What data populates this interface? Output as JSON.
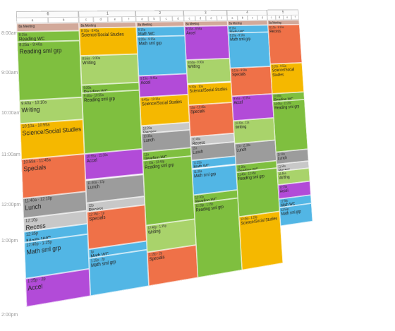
{
  "colors": {
    "green": "#7fbf3f",
    "lightgreen": "#a9d36b",
    "yellow": "#f5b800",
    "orange": "#ef7148",
    "purple": "#b24bd8",
    "gray": "#9c9c9c",
    "lightgray": "#c8c8c8",
    "blue": "#52b6e5",
    "tan": "#d2a99a"
  },
  "times": [
    "8:00am",
    "9:00am",
    "10:00am",
    "11:00am",
    "12:00pm",
    "1:00pm",
    "2:00pm"
  ],
  "days": [
    {
      "label": "6",
      "subs": [
        "a",
        "b"
      ],
      "events": [
        {
          "time": "",
          "title": "8a Meeting",
          "color": "tan",
          "start": 8.0,
          "end": 8.18,
          "small": true
        },
        {
          "time": "8:15a",
          "title": "Reading WC",
          "color": "green",
          "start": 8.18,
          "end": 8.4
        },
        {
          "time": "8:25a - 9:40a",
          "title": "Reading sml grp",
          "color": "green",
          "start": 8.4,
          "end": 9.67,
          "big": true
        },
        {
          "time": "9:40a - 10:10a",
          "title": "Writing",
          "color": "lightgreen",
          "start": 9.67,
          "end": 10.17,
          "big": true
        },
        {
          "time": "10:10a - 10:55a",
          "title": "Science/Social Studies",
          "color": "yellow",
          "start": 10.17,
          "end": 10.92,
          "big": true
        },
        {
          "time": "10:55a - 11:45a",
          "title": "Specials",
          "color": "orange",
          "start": 10.92,
          "end": 11.75,
          "big": true
        },
        {
          "time": "11:40a - 12:10p",
          "title": "Lunch",
          "color": "gray",
          "start": 11.75,
          "end": 12.17,
          "big": true
        },
        {
          "time": "12:10p",
          "title": "Recess",
          "color": "lightgray",
          "start": 12.17,
          "end": 12.45,
          "big": true
        },
        {
          "time": "12:35p",
          "title": "Math WC",
          "color": "blue",
          "start": 12.45,
          "end": 12.67,
          "big": true
        },
        {
          "time": "12:40p - 1:25p",
          "title": "Math sml grp",
          "color": "blue",
          "start": 12.67,
          "end": 13.42,
          "big": true
        },
        {
          "time": "1:25p - 2p",
          "title": "Accel",
          "color": "purple",
          "start": 13.42,
          "end": 14.0,
          "big": true
        }
      ]
    },
    {
      "label": "1",
      "subs": [
        "c",
        "d",
        "e",
        "f"
      ],
      "events": [
        {
          "time": "",
          "title": "8a Meeting",
          "color": "tan",
          "start": 8.0,
          "end": 8.12,
          "small": true
        },
        {
          "time": "8:10a - 8:45a",
          "title": "Science/Social Studies",
          "color": "yellow",
          "start": 8.12,
          "end": 8.75
        },
        {
          "time": "8:55a - 9:30a",
          "title": "Writing",
          "color": "lightgreen",
          "start": 8.75,
          "end": 9.4
        },
        {
          "time": "9:30a",
          "title": "Reading WC",
          "color": "green",
          "start": 9.4,
          "end": 9.58
        },
        {
          "time": "9:40a - 10:55a",
          "title": "Reading sml grp",
          "color": "green",
          "start": 9.58,
          "end": 10.92
        },
        {
          "time": "10:55a - 11:30a",
          "title": "Accel",
          "color": "purple",
          "start": 10.92,
          "end": 11.5
        },
        {
          "time": "11:30a - 12p",
          "title": "Lunch",
          "color": "gray",
          "start": 11.5,
          "end": 12.0
        },
        {
          "time": "12p",
          "title": "Recess",
          "color": "lightgray",
          "start": 12.0,
          "end": 12.2
        },
        {
          "time": "12:15p - 1p",
          "title": "Specials",
          "color": "orange",
          "start": 12.2,
          "end": 13.0
        },
        {
          "time": "1p",
          "title": "Math WC",
          "color": "blue",
          "start": 13.0,
          "end": 13.2
        },
        {
          "time": "1:15p - 2p",
          "title": "Math sml grp",
          "color": "blue",
          "start": 13.2,
          "end": 14.0
        }
      ]
    },
    {
      "label": "2",
      "subs": [
        "a",
        "b",
        "c",
        "d"
      ],
      "events": [
        {
          "time": "",
          "title": "8a Meeting",
          "color": "tan",
          "start": 8.0,
          "end": 8.12,
          "small": true
        },
        {
          "time": "8:15a",
          "title": "Math WC",
          "color": "blue",
          "start": 8.12,
          "end": 8.35
        },
        {
          "time": "8:20a - 9:15a",
          "title": "Math sml grp",
          "color": "blue",
          "start": 8.35,
          "end": 9.25
        },
        {
          "time": "9:15a - 9:45a",
          "title": "Accel",
          "color": "purple",
          "start": 9.25,
          "end": 9.75
        },
        {
          "time": "9:45a - 10:15a",
          "title": "Science/Social Studies",
          "color": "yellow",
          "start": 9.75,
          "end": 10.4
        },
        {
          "time": "10:20a",
          "title": "Recess",
          "color": "lightgray",
          "start": 10.4,
          "end": 10.58
        },
        {
          "time": "10:35a",
          "title": "Lunch",
          "color": "gray",
          "start": 10.58,
          "end": 11.0
        },
        {
          "time": "11a",
          "title": "Reading WC",
          "color": "green",
          "start": 11.0,
          "end": 11.2
        },
        {
          "time": "11:10a - 12:40p",
          "title": "Reading sml grp",
          "color": "green",
          "start": 11.2,
          "end": 12.65
        },
        {
          "time": "12:40p - 1:15p",
          "title": "Writing",
          "color": "lightgreen",
          "start": 12.65,
          "end": 13.25
        },
        {
          "time": "1:15p - 2p",
          "title": "Specials",
          "color": "orange",
          "start": 13.25,
          "end": 14.0
        }
      ]
    },
    {
      "label": "3",
      "subs": [
        "c",
        "d",
        "e",
        "f"
      ],
      "events": [
        {
          "time": "",
          "title": "8a Meeting",
          "color": "tan",
          "start": 8.0,
          "end": 8.12,
          "small": true
        },
        {
          "time": "8:10a - 8:55a",
          "title": "Accel",
          "color": "purple",
          "start": 8.12,
          "end": 8.92
        },
        {
          "time": "8:55a - 9:30a",
          "title": "Writing",
          "color": "lightgreen",
          "start": 8.92,
          "end": 9.5
        },
        {
          "time": "9:30a - 10a",
          "title": "Science/Social Studies",
          "color": "yellow",
          "start": 9.5,
          "end": 10.0
        },
        {
          "time": "10a - 10:45a",
          "title": "Specials",
          "color": "orange",
          "start": 10.0,
          "end": 10.75
        },
        {
          "time": "10:45a",
          "title": "Recess",
          "color": "lightgray",
          "start": 10.75,
          "end": 10.95
        },
        {
          "time": "11a",
          "title": "Lunch",
          "color": "gray",
          "start": 10.95,
          "end": 11.3
        },
        {
          "time": "11:25a",
          "title": "Math WC",
          "color": "blue",
          "start": 11.3,
          "end": 11.5
        },
        {
          "time": "11:30a",
          "title": "Math sml grp",
          "color": "blue",
          "start": 11.5,
          "end": 12.1
        },
        {
          "time": "12:10p",
          "title": "Reading WC",
          "color": "green",
          "start": 12.1,
          "end": 12.3
        },
        {
          "time": "12:20p - 1:15p",
          "title": "Reading sml grp",
          "color": "green",
          "start": 12.3,
          "end": 14.0
        }
      ]
    },
    {
      "label": "4",
      "subs": [
        "a",
        "b",
        "c",
        "d"
      ],
      "events": [
        {
          "time": "",
          "title": "8a Meeting",
          "color": "tan",
          "start": 8.0,
          "end": 8.12,
          "small": true
        },
        {
          "time": "8:10a",
          "title": "Math WC",
          "color": "blue",
          "start": 8.12,
          "end": 8.3
        },
        {
          "time": "8:20a - 9:10a",
          "title": "Math sml grp",
          "color": "blue",
          "start": 8.3,
          "end": 9.17
        },
        {
          "time": "9:10a - 9:50a",
          "title": "Specials",
          "color": "orange",
          "start": 9.17,
          "end": 9.85
        },
        {
          "time": "9:55a - 10:25a",
          "title": "Accel",
          "color": "purple",
          "start": 9.85,
          "end": 10.45
        },
        {
          "time": "10:30a - 11a",
          "title": "Writing",
          "color": "lightgreen",
          "start": 10.45,
          "end": 11.0
        },
        {
          "time": "11a - 11:30a",
          "title": "Lunch",
          "color": "gray",
          "start": 11.0,
          "end": 11.5
        },
        {
          "time": "11:30a",
          "title": "Reading WC",
          "color": "green",
          "start": 11.5,
          "end": 11.68
        },
        {
          "time": "11:40a - 12:45p",
          "title": "Reading sml grp",
          "color": "green",
          "start": 11.68,
          "end": 12.75
        },
        {
          "time": "12:45p - 1:20p",
          "title": "Science/Social Studies",
          "color": "yellow",
          "start": 12.75,
          "end": 14.0
        }
      ]
    },
    {
      "label": "5",
      "subs": [
        "c",
        "d",
        "e",
        "f"
      ],
      "events": [
        {
          "time": "",
          "title": "8a Meeting",
          "color": "tan",
          "start": 8.0,
          "end": 8.12,
          "small": true
        },
        {
          "time": "8:10a - 9:10a",
          "title": "Recess",
          "color": "orange",
          "start": 8.12,
          "end": 9.1
        },
        {
          "time": "9:10a - 9:55a",
          "title": "Science/Social Studies",
          "color": "yellow",
          "start": 9.1,
          "end": 9.85
        },
        {
          "time": "10:05a",
          "title": "Reading WC",
          "color": "green",
          "start": 9.85,
          "end": 10.05
        },
        {
          "time": "10:05a - 11:20a",
          "title": "Reading sml grp",
          "color": "green",
          "start": 10.05,
          "end": 11.3
        },
        {
          "time": "11:20a",
          "title": "Lunch",
          "color": "gray",
          "start": 11.3,
          "end": 11.6
        },
        {
          "time": "11:50a",
          "title": "Recess",
          "color": "lightgray",
          "start": 11.6,
          "end": 11.78
        },
        {
          "time": "11:55a",
          "title": "Writing",
          "color": "lightgreen",
          "start": 11.78,
          "end": 12.1
        },
        {
          "time": "12:25p",
          "title": "Accel",
          "color": "purple",
          "start": 12.1,
          "end": 12.45
        },
        {
          "time": "12:50p",
          "title": "Math WC",
          "color": "blue",
          "start": 12.45,
          "end": 12.65
        },
        {
          "time": "12:55p",
          "title": "Math sml grp",
          "color": "blue",
          "start": 12.65,
          "end": 13.1
        }
      ]
    }
  ]
}
